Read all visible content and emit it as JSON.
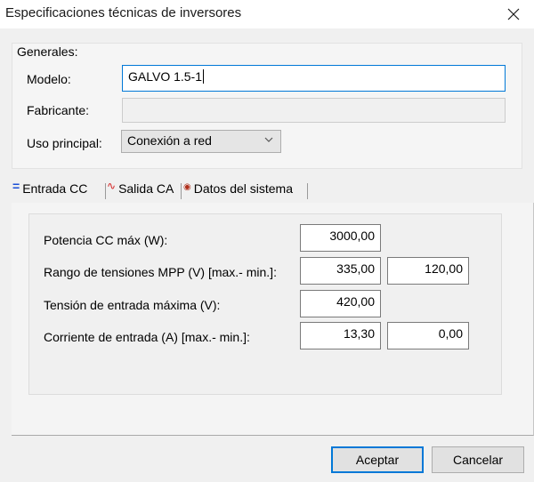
{
  "window": {
    "title": "Especificaciones técnicas de inversores"
  },
  "general": {
    "group_label": "Generales:",
    "model_label": "Modelo:",
    "model_value": "GALVO 1.5-1",
    "manufacturer_label": "Fabricante:",
    "manufacturer_value": "",
    "use_label": "Uso principal:",
    "use_value": "Conexión a red"
  },
  "tabs": [
    {
      "label": "Entrada CC",
      "icon": "=",
      "icon_color": "#1a4fd6"
    },
    {
      "label": "Salida CA",
      "icon": "∿",
      "icon_color": "#d42020"
    },
    {
      "label": "Datos del sistema",
      "icon": "◉",
      "icon_color": "#b0301c"
    }
  ],
  "entrada_cc": {
    "potencia_label": "Potencia CC máx (W):",
    "potencia_value": "3000,00",
    "rango_label": "Rango de tensiones MPP (V) [max.- min.]:",
    "rango_max": "335,00",
    "rango_min": "120,00",
    "tension_label": "Tensión de entrada máxima (V):",
    "tension_value": "420,00",
    "corriente_label": "Corriente de entrada (A) [max.- min.]:",
    "corriente_max": "13,30",
    "corriente_min": "0,00"
  },
  "buttons": {
    "ok": "Aceptar",
    "cancel": "Cancelar"
  }
}
